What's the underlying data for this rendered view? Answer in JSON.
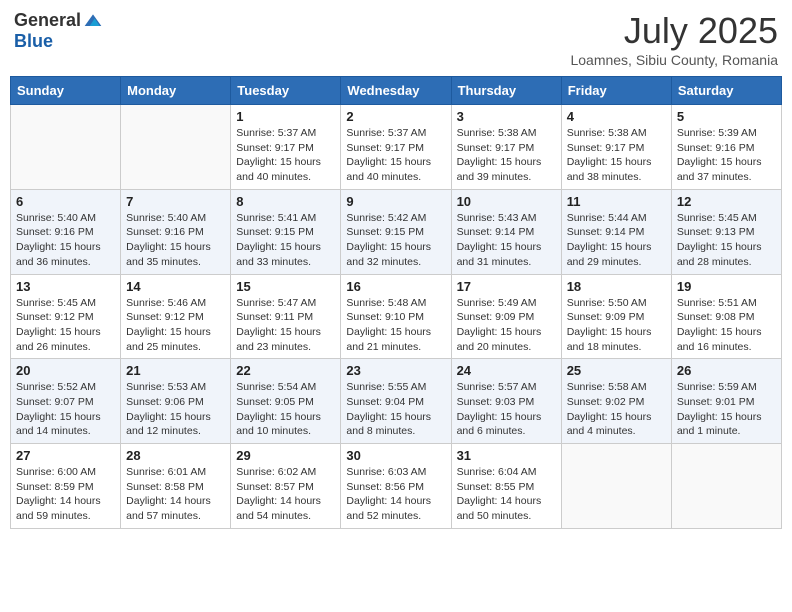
{
  "header": {
    "logo_general": "General",
    "logo_blue": "Blue",
    "month_year": "July 2025",
    "location": "Loamnes, Sibiu County, Romania"
  },
  "weekdays": [
    "Sunday",
    "Monday",
    "Tuesday",
    "Wednesday",
    "Thursday",
    "Friday",
    "Saturday"
  ],
  "weeks": [
    [
      {
        "day": "",
        "content": ""
      },
      {
        "day": "",
        "content": ""
      },
      {
        "day": "1",
        "content": "Sunrise: 5:37 AM\nSunset: 9:17 PM\nDaylight: 15 hours and 40 minutes."
      },
      {
        "day": "2",
        "content": "Sunrise: 5:37 AM\nSunset: 9:17 PM\nDaylight: 15 hours and 40 minutes."
      },
      {
        "day": "3",
        "content": "Sunrise: 5:38 AM\nSunset: 9:17 PM\nDaylight: 15 hours and 39 minutes."
      },
      {
        "day": "4",
        "content": "Sunrise: 5:38 AM\nSunset: 9:17 PM\nDaylight: 15 hours and 38 minutes."
      },
      {
        "day": "5",
        "content": "Sunrise: 5:39 AM\nSunset: 9:16 PM\nDaylight: 15 hours and 37 minutes."
      }
    ],
    [
      {
        "day": "6",
        "content": "Sunrise: 5:40 AM\nSunset: 9:16 PM\nDaylight: 15 hours and 36 minutes."
      },
      {
        "day": "7",
        "content": "Sunrise: 5:40 AM\nSunset: 9:16 PM\nDaylight: 15 hours and 35 minutes."
      },
      {
        "day": "8",
        "content": "Sunrise: 5:41 AM\nSunset: 9:15 PM\nDaylight: 15 hours and 33 minutes."
      },
      {
        "day": "9",
        "content": "Sunrise: 5:42 AM\nSunset: 9:15 PM\nDaylight: 15 hours and 32 minutes."
      },
      {
        "day": "10",
        "content": "Sunrise: 5:43 AM\nSunset: 9:14 PM\nDaylight: 15 hours and 31 minutes."
      },
      {
        "day": "11",
        "content": "Sunrise: 5:44 AM\nSunset: 9:14 PM\nDaylight: 15 hours and 29 minutes."
      },
      {
        "day": "12",
        "content": "Sunrise: 5:45 AM\nSunset: 9:13 PM\nDaylight: 15 hours and 28 minutes."
      }
    ],
    [
      {
        "day": "13",
        "content": "Sunrise: 5:45 AM\nSunset: 9:12 PM\nDaylight: 15 hours and 26 minutes."
      },
      {
        "day": "14",
        "content": "Sunrise: 5:46 AM\nSunset: 9:12 PM\nDaylight: 15 hours and 25 minutes."
      },
      {
        "day": "15",
        "content": "Sunrise: 5:47 AM\nSunset: 9:11 PM\nDaylight: 15 hours and 23 minutes."
      },
      {
        "day": "16",
        "content": "Sunrise: 5:48 AM\nSunset: 9:10 PM\nDaylight: 15 hours and 21 minutes."
      },
      {
        "day": "17",
        "content": "Sunrise: 5:49 AM\nSunset: 9:09 PM\nDaylight: 15 hours and 20 minutes."
      },
      {
        "day": "18",
        "content": "Sunrise: 5:50 AM\nSunset: 9:09 PM\nDaylight: 15 hours and 18 minutes."
      },
      {
        "day": "19",
        "content": "Sunrise: 5:51 AM\nSunset: 9:08 PM\nDaylight: 15 hours and 16 minutes."
      }
    ],
    [
      {
        "day": "20",
        "content": "Sunrise: 5:52 AM\nSunset: 9:07 PM\nDaylight: 15 hours and 14 minutes."
      },
      {
        "day": "21",
        "content": "Sunrise: 5:53 AM\nSunset: 9:06 PM\nDaylight: 15 hours and 12 minutes."
      },
      {
        "day": "22",
        "content": "Sunrise: 5:54 AM\nSunset: 9:05 PM\nDaylight: 15 hours and 10 minutes."
      },
      {
        "day": "23",
        "content": "Sunrise: 5:55 AM\nSunset: 9:04 PM\nDaylight: 15 hours and 8 minutes."
      },
      {
        "day": "24",
        "content": "Sunrise: 5:57 AM\nSunset: 9:03 PM\nDaylight: 15 hours and 6 minutes."
      },
      {
        "day": "25",
        "content": "Sunrise: 5:58 AM\nSunset: 9:02 PM\nDaylight: 15 hours and 4 minutes."
      },
      {
        "day": "26",
        "content": "Sunrise: 5:59 AM\nSunset: 9:01 PM\nDaylight: 15 hours and 1 minute."
      }
    ],
    [
      {
        "day": "27",
        "content": "Sunrise: 6:00 AM\nSunset: 8:59 PM\nDaylight: 14 hours and 59 minutes."
      },
      {
        "day": "28",
        "content": "Sunrise: 6:01 AM\nSunset: 8:58 PM\nDaylight: 14 hours and 57 minutes."
      },
      {
        "day": "29",
        "content": "Sunrise: 6:02 AM\nSunset: 8:57 PM\nDaylight: 14 hours and 54 minutes."
      },
      {
        "day": "30",
        "content": "Sunrise: 6:03 AM\nSunset: 8:56 PM\nDaylight: 14 hours and 52 minutes."
      },
      {
        "day": "31",
        "content": "Sunrise: 6:04 AM\nSunset: 8:55 PM\nDaylight: 14 hours and 50 minutes."
      },
      {
        "day": "",
        "content": ""
      },
      {
        "day": "",
        "content": ""
      }
    ]
  ]
}
